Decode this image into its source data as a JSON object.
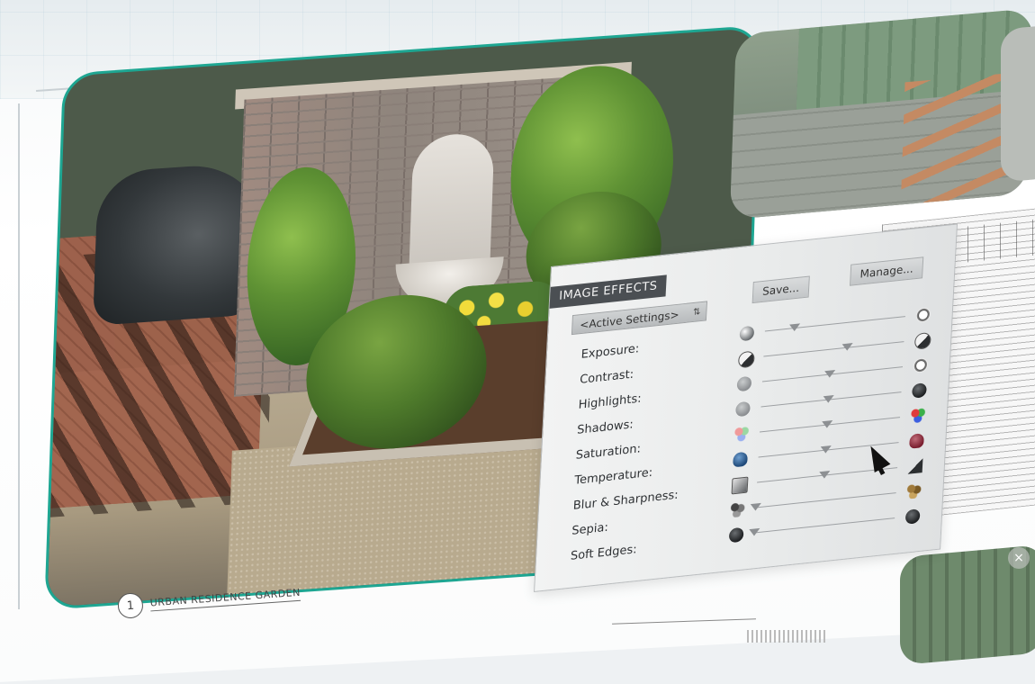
{
  "panel": {
    "title": "IMAGE EFFECTS",
    "save_label": "Save...",
    "manage_label": "Manage...",
    "preset_select": "<Active Settings>",
    "rows": [
      {
        "label": "Exposure:",
        "left_icon": "gradient-ball-icon",
        "right_icon": "ring-icon",
        "value": 0.22
      },
      {
        "label": "Contrast:",
        "left_icon": "half-contrast-icon",
        "right_icon": "half-contrast-icon",
        "value": 0.62
      },
      {
        "label": "Highlights:",
        "left_icon": "grey-ball-icon",
        "right_icon": "light-ball-icon",
        "value": 0.5
      },
      {
        "label": "Shadows:",
        "left_icon": "grey-ball-icon",
        "right_icon": "dark-ball-icon",
        "value": 0.5
      },
      {
        "label": "Saturation:",
        "left_icon": "pastel-rgb-icon",
        "right_icon": "rgb-icon",
        "value": 0.5
      },
      {
        "label": "Temperature:",
        "left_icon": "blue-bulb-icon",
        "right_icon": "red-bulb-icon",
        "value": 0.5
      },
      {
        "label": "Blur & Sharpness:",
        "left_icon": "blur-square-icon",
        "right_icon": "sharp-triangle-icon",
        "value": 0.5
      },
      {
        "label": "Sepia:",
        "left_icon": "grey-dots-icon",
        "right_icon": "sepia-dots-icon",
        "value": 0.0
      },
      {
        "label": "Soft Edges:",
        "left_icon": "dark-ball-icon",
        "right_icon": "dark-ball-icon",
        "value": 0.0
      }
    ]
  },
  "caption": {
    "number": "1",
    "text": "URBAN RESIDENCE GARDEN"
  },
  "colors": {
    "frame_accent": "#1ea692",
    "panel_title_bg": "#4b4f53"
  }
}
